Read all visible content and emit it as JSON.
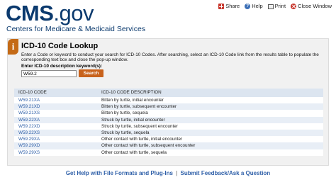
{
  "header": {
    "logo_main": "CMS",
    "logo_dot": ".",
    "logo_gov": "gov",
    "tagline": "Centers for Medicare & Medicaid Services",
    "links": [
      {
        "label": "Share",
        "icon": "share-icon"
      },
      {
        "label": "Help",
        "icon": "help-icon"
      },
      {
        "label": "Print",
        "icon": "print-icon"
      },
      {
        "label": "Close Window",
        "icon": "close-icon"
      }
    ]
  },
  "panel": {
    "info_glyph": "i",
    "title": "ICD-10 Code Lookup",
    "instructions": "Enter a Code or keyword to conduct your search for ICD-10 Codes.  After searching, select an ICD-10 Code link from the results table to populate the corresponding text box and close the pop-up window.",
    "field_label": "Enter ICD-10 description keyword(s):",
    "search_value": "W59.2",
    "search_button": "Search"
  },
  "table": {
    "headers": [
      "ICD-10 CODE",
      "ICD-10 CODE DESCRIPTION"
    ],
    "rows": [
      {
        "code": "W59.21XA",
        "desc": "Bitten by turtle, initial encounter"
      },
      {
        "code": "W59.21XD",
        "desc": "Bitten by turtle, subsequent encounter"
      },
      {
        "code": "W59.21XS",
        "desc": "Bitten by turtle, sequela"
      },
      {
        "code": "W59.22XA",
        "desc": "Struck by turtle, initial encounter"
      },
      {
        "code": "W59.22XD",
        "desc": "Struck by turtle, subsequent encounter"
      },
      {
        "code": "W59.22XS",
        "desc": "Struck by turtle, sequela"
      },
      {
        "code": "W59.29XA",
        "desc": "Other contact with turtle, initial encounter"
      },
      {
        "code": "W59.29XD",
        "desc": "Other contact with turtle, subsequent encounter"
      },
      {
        "code": "W59.29XS",
        "desc": "Other contact with turtle, sequela"
      }
    ]
  },
  "footer": {
    "link1": "Get Help with File Formats and Plug-Ins",
    "separator": "|",
    "link2": "Submit Feedback/Ask a Question"
  },
  "colors": {
    "brand_navy": "#0b3a6e",
    "link_blue": "#2e5fa8",
    "button_orange": "#c8621b",
    "info_orange": "#c46a16",
    "header_row_bg": "#dce5f0"
  }
}
